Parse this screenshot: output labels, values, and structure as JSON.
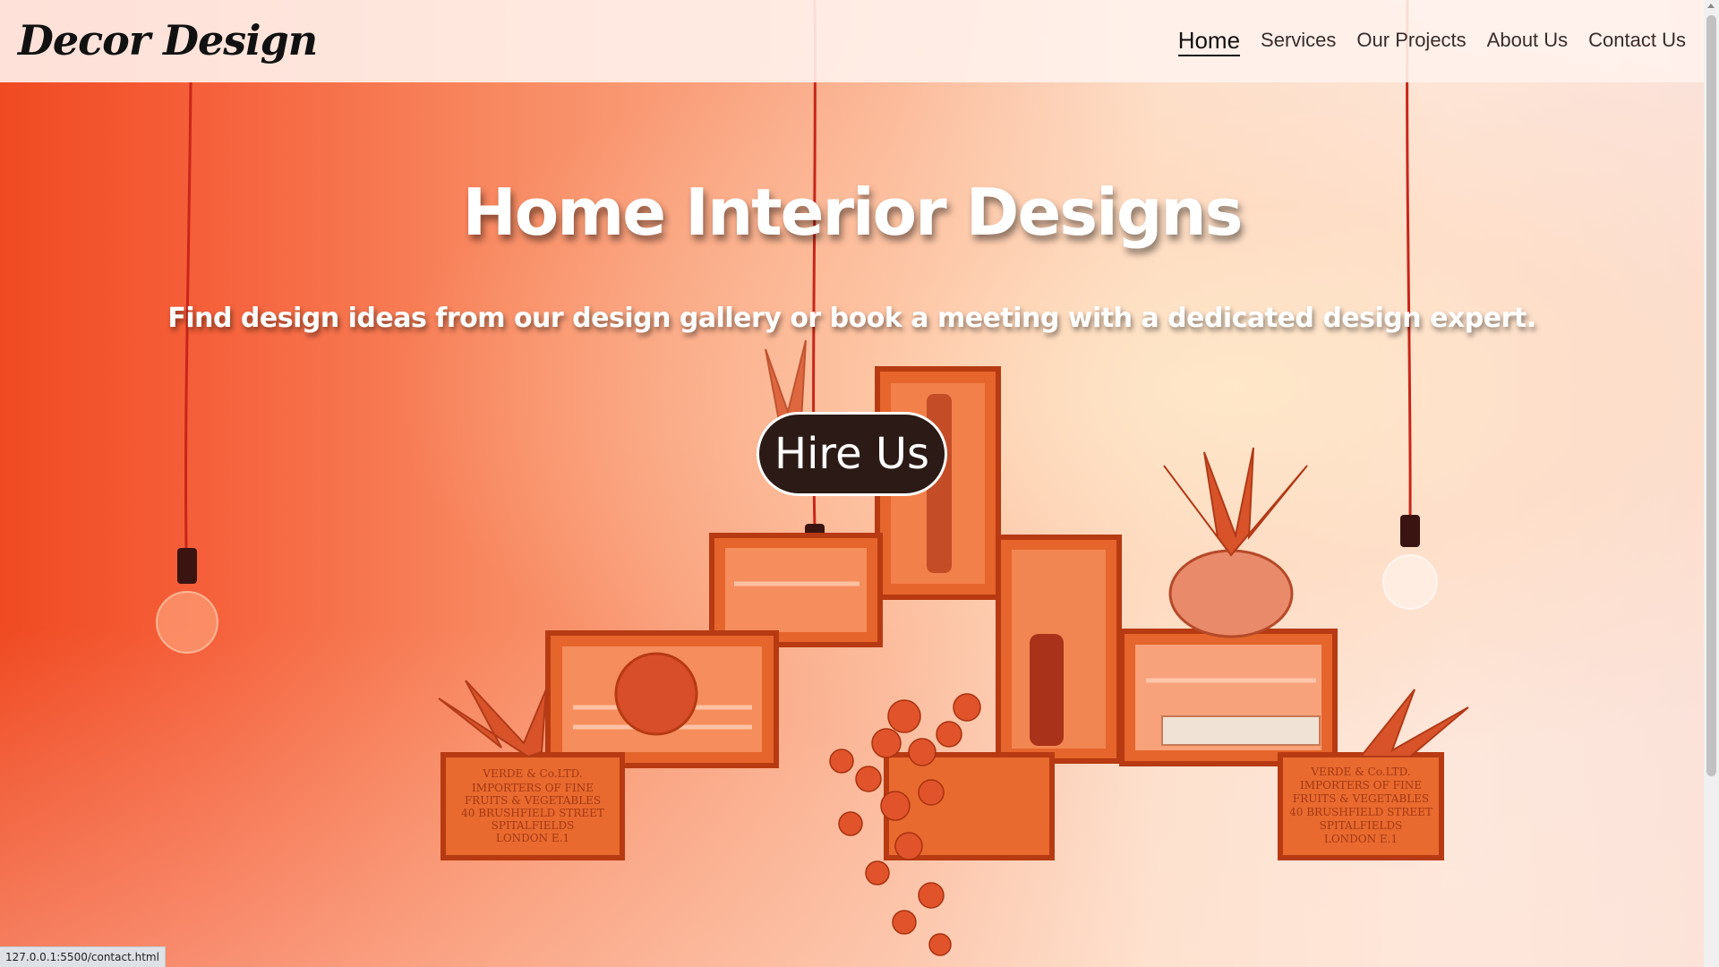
{
  "brand": {
    "logo_text": "Decor Design"
  },
  "nav": {
    "items": [
      {
        "label": "Home",
        "active": true
      },
      {
        "label": "Services",
        "active": false
      },
      {
        "label": "Our Projects",
        "active": false
      },
      {
        "label": "About Us",
        "active": false
      },
      {
        "label": "Contact Us",
        "active": false
      }
    ]
  },
  "hero": {
    "title": "Home Interior Designs",
    "subtitle": "Find design ideas from our design gallery or book a meeting with a dedicated design expert.",
    "cta_label": "Hire Us",
    "crate_label_lines": [
      "VERDE & Co.LTD.",
      "IMPORTERS OF FINE",
      "FRUITS & VEGETABLES",
      "40 BRUSHFIELD STREET",
      "SPITALFIELDS",
      "LONDON E.1"
    ]
  },
  "status_bar": {
    "url": "127.0.0.1:5500/contact.html"
  },
  "colors": {
    "accent_orange": "#f04a22",
    "button_bg": "#2b1a15",
    "text_white": "#ffffff",
    "nav_text": "#3a2c2a"
  }
}
